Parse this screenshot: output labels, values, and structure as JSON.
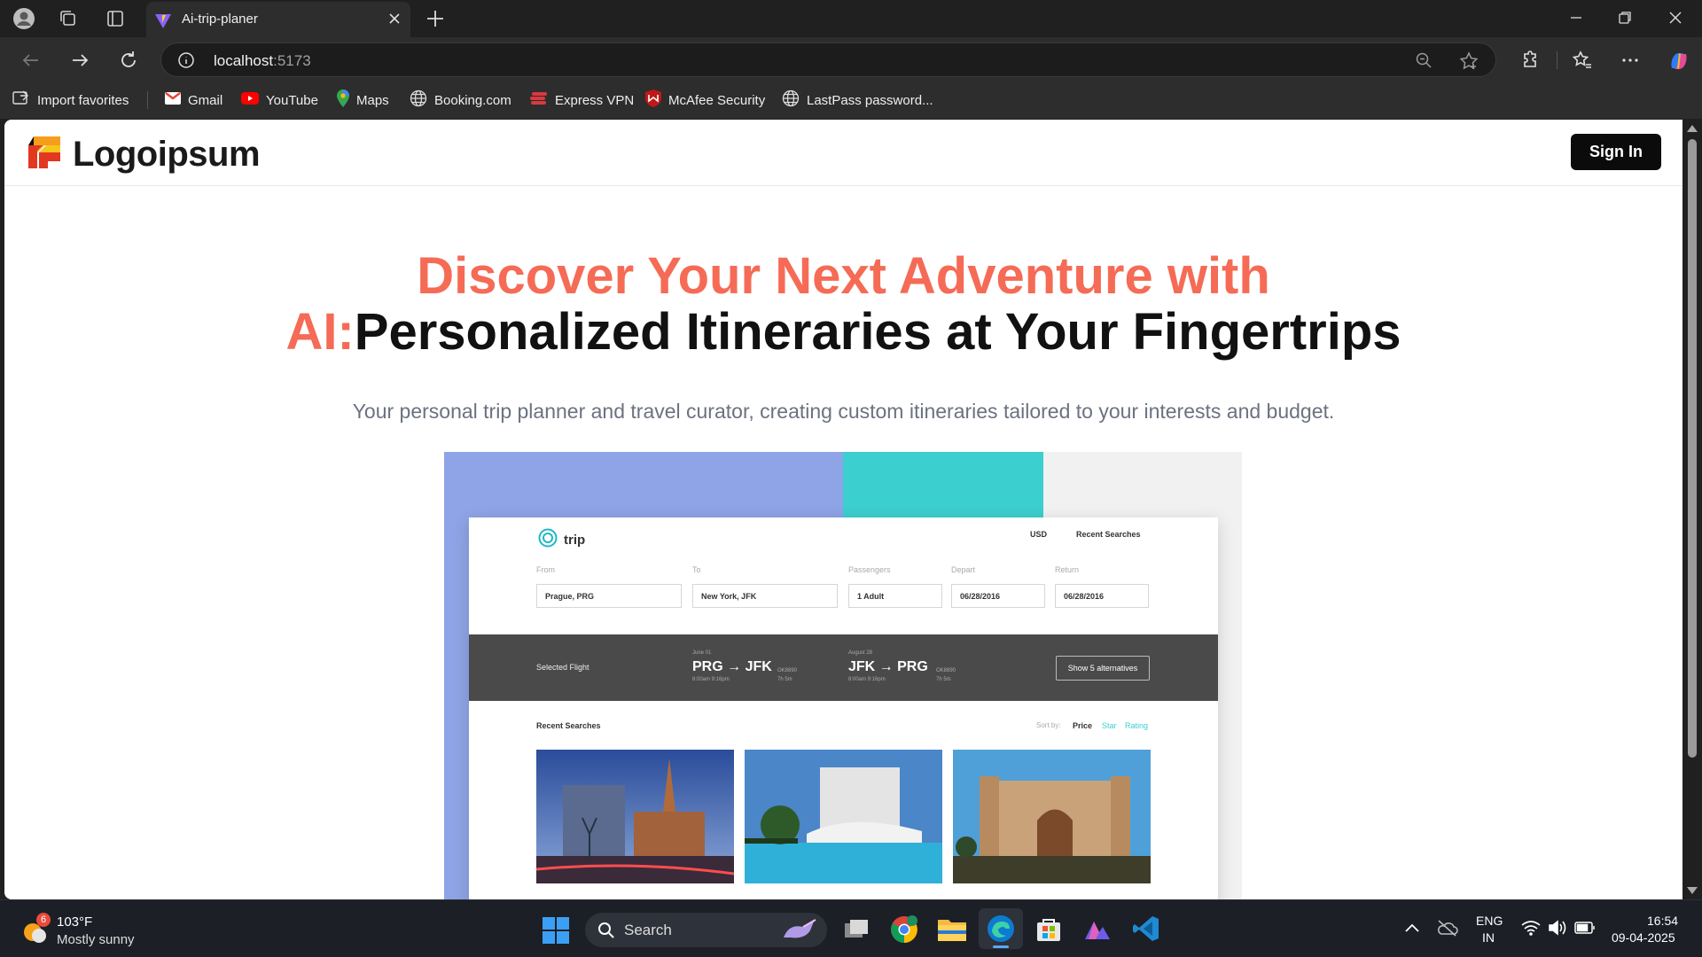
{
  "browser": {
    "tab_title": "Ai-trip-planer",
    "url_host": "localhost",
    "url_port": ":5173",
    "favorites": [
      {
        "label": "Import favorites",
        "icon": "import-icon"
      },
      {
        "label": "Gmail",
        "icon": "gmail-icon"
      },
      {
        "label": "YouTube",
        "icon": "youtube-icon"
      },
      {
        "label": "Maps",
        "icon": "maps-icon"
      },
      {
        "label": "Booking.com",
        "icon": "globe-icon"
      },
      {
        "label": "Express VPN",
        "icon": "expressvpn-icon"
      },
      {
        "label": "McAfee Security",
        "icon": "mcafee-icon"
      },
      {
        "label": "LastPass password...",
        "icon": "globe-icon"
      }
    ]
  },
  "site": {
    "logo_text": "Logoipsum",
    "signin_label": "Sign In",
    "hero_accent_1": "Discover Your Next Adventure with",
    "hero_accent_2": "AI:",
    "hero_dark": "Personalized Itineraries at Your Fingertrips",
    "hero_subtitle": "Your personal trip planner and travel curator, creating custom itineraries tailored to your interests and budget."
  },
  "mockup": {
    "brand": "trip",
    "currency": "USD",
    "recent_searches": "Recent Searches",
    "labels": {
      "from": "From",
      "to": "To",
      "passengers": "Passengers",
      "depart": "Depart",
      "return": "Return"
    },
    "values": {
      "from": "Prague, PRG",
      "to": "New York, JFK",
      "passengers": "1 Adult",
      "depart": "06/28/2016",
      "return": "06/28/2016"
    },
    "selected_flight": "Selected Flight",
    "outbound": {
      "date": "June 01",
      "route": "PRG → JFK",
      "code": "OK8890",
      "times": "8:00am   9:16pm",
      "duration": "7h 5m"
    },
    "inbound": {
      "date": "August 28",
      "route": "JFK → PRG",
      "code": "OK8890",
      "times": "8:00am   9:16pm",
      "duration": "7h 5m"
    },
    "alternatives_button": "Show 5 alternatives",
    "sort_by": "Sort by:",
    "sort_options": [
      "Price",
      "Star",
      "Rating"
    ]
  },
  "taskbar": {
    "weather_temp": "103°F",
    "weather_desc": "Mostly sunny",
    "weather_badge": "6",
    "search_label": "Search",
    "lang_1": "ENG",
    "lang_2": "IN",
    "time": "16:54",
    "date": "09-04-2025"
  },
  "colors": {
    "accent": "#f56b56",
    "mock_blue": "#8fa4e6",
    "mock_teal": "#3ccfcf"
  }
}
